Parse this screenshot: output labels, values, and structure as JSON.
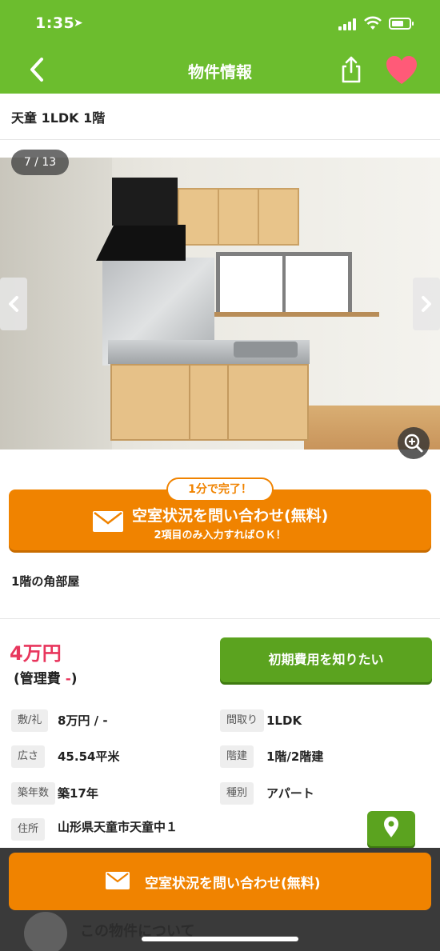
{
  "status": {
    "time": "1:35"
  },
  "nav": {
    "title": "物件情報"
  },
  "property": {
    "title": "天童 1LDK 1階"
  },
  "gallery": {
    "counter": "7 / 13"
  },
  "cta": {
    "badge": "1分で完了！",
    "main_label": "空室状況を問い合わせ(無料)",
    "sub_label": "2項目のみ入力すればＯＫ！",
    "sticky_label": "空室状況を問い合わせ(無料)"
  },
  "feature": "1階の角部屋",
  "price": {
    "rent": "4万円",
    "mgmt_prefix": "(管理費 ",
    "mgmt_value": "-",
    "mgmt_suffix": ")",
    "cost_button": "初期費用を知りたい"
  },
  "specs": {
    "deposit_key": {
      "label": "敷/礼",
      "value": "8万円 / -"
    },
    "layout": {
      "label": "間取り",
      "value": "1LDK"
    },
    "area": {
      "label": "広さ",
      "value": "45.54平米"
    },
    "floor": {
      "label": "階建",
      "value": "1階/2階建"
    },
    "age": {
      "label": "築年数",
      "value": "築17年"
    },
    "type": {
      "label": "種別",
      "value": "アパート"
    },
    "address": {
      "label": "住所",
      "value": "山形県天童市天童中１"
    }
  },
  "bottom": {
    "section_title": "この物件について"
  },
  "colors": {
    "green": "#6cbd2e",
    "orange": "#f08300",
    "pink": "#e8365d"
  }
}
